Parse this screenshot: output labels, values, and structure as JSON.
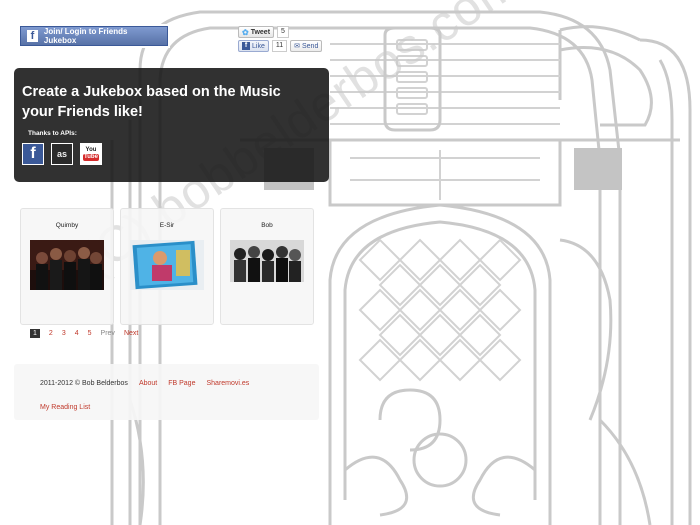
{
  "background": {
    "watermark": "(C) bobbelderbos.com"
  },
  "login": {
    "icon": "facebook-icon",
    "label": "Join/ Login to Friends Jukebox"
  },
  "social": {
    "tweet_label": "Tweet",
    "tweet_count": "5",
    "like_label": "Like",
    "like_count": "11",
    "send_label": "Send"
  },
  "hero": {
    "title": "Create a Jukebox based on the Music your Friends like!",
    "thanks_label": "Thanks to APIs:",
    "apis": [
      {
        "name": "Facebook",
        "icon": "facebook-icon"
      },
      {
        "name": "Last.fm",
        "icon": "lastfm-icon"
      },
      {
        "name": "YouTube",
        "icon": "youtube-icon"
      }
    ]
  },
  "artists": [
    {
      "name": "Quimby"
    },
    {
      "name": "E-Sir"
    },
    {
      "name": "Bob"
    }
  ],
  "pagination": {
    "pages": [
      "1",
      "2",
      "3",
      "4",
      "5"
    ],
    "current": 1,
    "prev_label": "Prev",
    "next_label": "Next"
  },
  "footer": {
    "copyright": "2011-2012 © Bob Belderbos",
    "links": [
      "About",
      "FB Page",
      "Sharemovi.es"
    ],
    "reading_list": "My Reading List"
  },
  "colors": {
    "link": "#c0392b",
    "facebook_blue": "#3b5998",
    "hero_background": "#141414",
    "jukebox_lines": "#c9c9c9"
  }
}
